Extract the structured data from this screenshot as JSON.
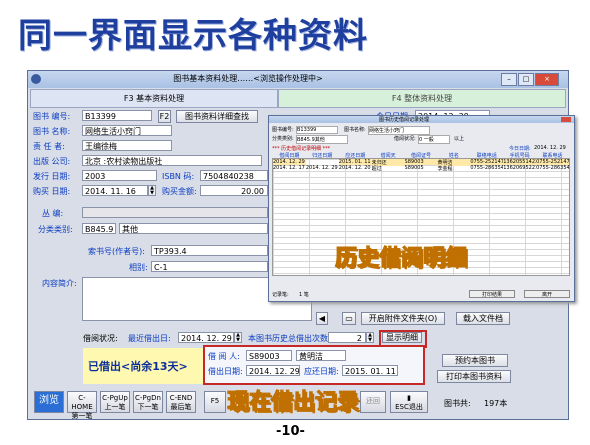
{
  "slide": {
    "title": "同一界面显示各种资料",
    "page_number": "-10-",
    "callout_history": "历史借阅明细",
    "callout_current": "现在借出记录"
  },
  "window": {
    "title": "图书基本资料处理……<浏览操作处理中>",
    "tab_basic": "F3 基本资料处理",
    "tab_overall": "F4 整体资料处理"
  },
  "form": {
    "book_no_label": "图书 编号:",
    "book_no": "B13399",
    "f2_key": "F2",
    "detail_search_button": "图书资料详细查找",
    "today_label": "今日日期:",
    "today_date": "2014. 12. 29",
    "book_name_label": "图书 名称:",
    "book_name": "网络生活小窍门",
    "author_label": "责 任 者:",
    "author": "王编徐梅",
    "publisher_label": "出版 公司:",
    "publisher": "北京 :农村读物出版社",
    "release_date_label": "发行 日期:",
    "release_date": "2003",
    "isbn_label": "ISBN 码:",
    "isbn": "7504840238",
    "purchase_date_label": "购买 日期:",
    "purchase_date": "2014. 11. 16",
    "purchase_amount_label": "购买金额:",
    "purchase_amount": "20.00",
    "series_label": "丛 编:",
    "series": "",
    "category_label": "分类类别:",
    "category_code": "B845.9",
    "category_name": "其他",
    "call_no_label": "索书号(作者号):",
    "call_no": "TP393.4",
    "shelf_label": "相别:",
    "shelf": "C-1",
    "summary_label": "内容简介:",
    "attach_open_button": "开启附件文件夹(O)",
    "attach_load_button": "载入文件档"
  },
  "borrow": {
    "status_label": "借阅状况:",
    "last_borrow_label": "最近借出日:",
    "last_borrow_date": "2014. 12. 29",
    "history_count_label": "本图书历史总借出次数:",
    "history_count": "2",
    "show_detail_button": "显示明细",
    "status_text": "已借出<尚余13天>",
    "borrower_label": "借 阅 人:",
    "borrower_id": "S89003",
    "borrower_name": "黄明洁",
    "borrow_date_label": "借出日期:",
    "borrow_date": "2014. 12. 29",
    "due_label": "应还日期:",
    "due_date": "2015. 01. 11",
    "reserve_button": "预约本图书",
    "print_button": "打印本图书资料"
  },
  "toolbar": {
    "browse": "浏览",
    "first_key": "C-HOME",
    "first_label": "第一笔",
    "prev_key": "C-PgUp",
    "prev_label": "上一笔",
    "next_key": "C-PgDn",
    "next_label": "下一笔",
    "last_key": "C-END",
    "last_label": "最后笔",
    "f5_label": "F5",
    "return_label": "还回",
    "esc_label": "ESC退出",
    "total_label": "图书共:",
    "total_value": "197本"
  },
  "history_window": {
    "title": "图书历史借阅记录处理",
    "book_no_label": "图书编号:",
    "book_no": "B13399",
    "book_name_label": "图书名称:",
    "book_name": "网络生活小窍门",
    "category_label": "分类类别:",
    "category": "B845.9其他",
    "borrow_count_label": "借阅状况:",
    "borrow_count": "0 一般",
    "above_label": "以上",
    "section_label": "*** 历史借阅记录明细 ***",
    "today_label": "今日日期:",
    "today": "2014. 12. 29",
    "columns": [
      "借阅日期",
      "归还日期",
      "应还日期",
      "借阅天",
      "借阅证号",
      "姓名",
      "联络电话",
      "手机号码",
      "联系电话"
    ],
    "rows": [
      [
        "2014. 12. 29",
        "",
        "2015. 01. 11",
        "未归还",
        "S89003",
        "黄明洁",
        "0755-25214713",
        "13620551423",
        "0755-25214713"
      ],
      [
        "2014. 12. 17",
        "2014. 12. 29",
        "2014. 12. 20",
        "超过",
        "S89005",
        "李金程",
        "0755-28635418",
        "13620695221",
        "0755-28635418"
      ]
    ],
    "footer_count_label": "记录笔:",
    "footer_count": "1 笔",
    "footer_print": "打印结果",
    "footer_close": "离开"
  }
}
